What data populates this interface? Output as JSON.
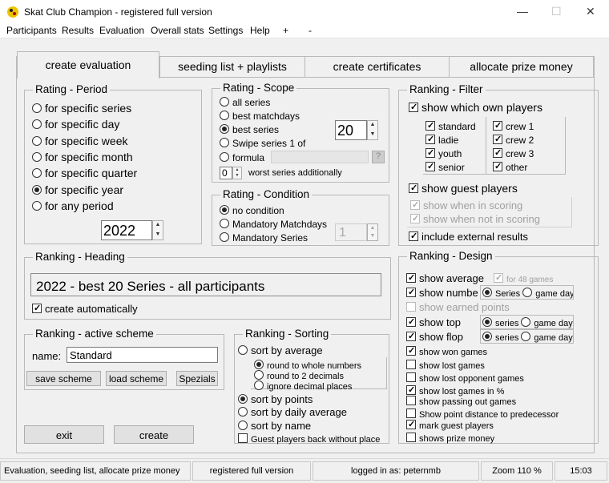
{
  "window": {
    "title": "Skat Club Champion - registered full version"
  },
  "menu": [
    "Participants",
    "Results",
    "Evaluation",
    "Overall stats",
    "Settings",
    "Help",
    "+",
    "-"
  ],
  "tabs": [
    "create evaluation",
    "seeding list + playlists",
    "create certificates",
    "allocate prize money"
  ],
  "rating_period": {
    "title": "Rating - Period",
    "options": [
      "for specific series",
      "for specific day",
      "for specific week",
      "for specific month",
      "for specific quarter",
      "for specific year",
      "for any period"
    ],
    "selected": "for specific year",
    "year": "2022"
  },
  "rating_scope": {
    "title": "Rating - Scope",
    "options": [
      "all series",
      "best matchdays",
      "best series",
      "Swipe series 1 of",
      "formula"
    ],
    "selected": "best series",
    "best_count": "20",
    "worst_count": "0",
    "worst_label": "worst series additionally",
    "help": "?"
  },
  "rating_condition": {
    "title": "Rating - Condition",
    "options": [
      "no condition",
      "Mandatory Matchdays",
      "Mandatory Series"
    ],
    "selected": "no condition",
    "value": "1"
  },
  "ranking_filter": {
    "title": "Ranking - Filter",
    "show_own": "show which own players",
    "groups": [
      "standard",
      "ladie",
      "youth",
      "senior"
    ],
    "crews": [
      "crew 1",
      "crew 2",
      "crew 3",
      "other"
    ],
    "guest": "show guest players",
    "in_scoring": "show when in scoring",
    "not_in_scoring": "show when not in scoring",
    "external": "include external results"
  },
  "ranking_heading": {
    "title": "Ranking - Heading",
    "value": "2022 - best 20 Series - all participants",
    "auto": "create automatically"
  },
  "active_scheme": {
    "title": "Ranking - active scheme",
    "name_label": "name:",
    "name_value": "Standard",
    "save": "save scheme",
    "load": "load scheme",
    "special": "Spezials"
  },
  "ranking_sorting": {
    "title": "Ranking - Sorting",
    "by_average": "sort by average",
    "round_whole": "round to whole numbers",
    "round_2": "round to 2 decimals",
    "ignore_dec": "ignore decimal places",
    "by_points": "sort by points",
    "by_daily": "sort by daily average",
    "by_name": "sort by name",
    "guest_back": "Guest players back without place"
  },
  "ranking_design": {
    "title": "Ranking - Design",
    "show_average": "show average",
    "for_games": "for 48 games",
    "show_number": "show number",
    "series": "Series",
    "game_day": "game day",
    "show_earned": "show earned points",
    "show_top": "show top",
    "show_flop": "show flop",
    "series_lc": "series",
    "game_day_lc": "game day",
    "show_won": "show won games",
    "show_lost": "show lost games",
    "show_lost_opp": "show lost opponent games",
    "show_lost_pct": "show lost games in %",
    "show_passing": "show passing out games",
    "show_distance": "Show point distance to predecessor",
    "mark_guest": "mark guest players",
    "show_prize": "shows prize money"
  },
  "buttons": {
    "exit": "exit",
    "create": "create"
  },
  "status": {
    "left": "Evaluation, seeding list, allocate prize money",
    "version": "registered full version",
    "user": "logged in as: peternmb",
    "zoom": "Zoom 110 %",
    "time": "15:03"
  }
}
